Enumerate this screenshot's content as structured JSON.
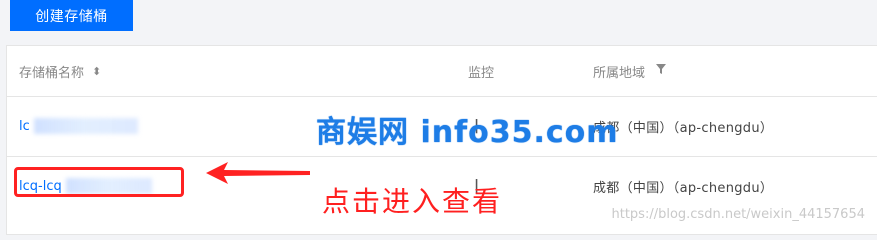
{
  "toolbar": {
    "create_bucket_label": "创建存储桶"
  },
  "table": {
    "headers": {
      "name": "存储桶名称",
      "monitor": "监控",
      "region": "所属地域"
    },
    "rows": [
      {
        "name": "lc",
        "monitor": "|",
        "region": "成都（中国）（ap-chengdu）"
      },
      {
        "name": "lcq-lcq",
        "monitor": "|",
        "region": "成都（中国）（ap-chengdu）"
      }
    ]
  },
  "overlay": {
    "watermark": "商娱网 info35.com",
    "annotation": "点击进入查看",
    "site_watermark": "https://blog.csdn.net/weixin_44157654"
  },
  "colors": {
    "primary": "#006eff",
    "annotation_red": "#ff2222",
    "watermark_blue": "#1e7de6"
  }
}
